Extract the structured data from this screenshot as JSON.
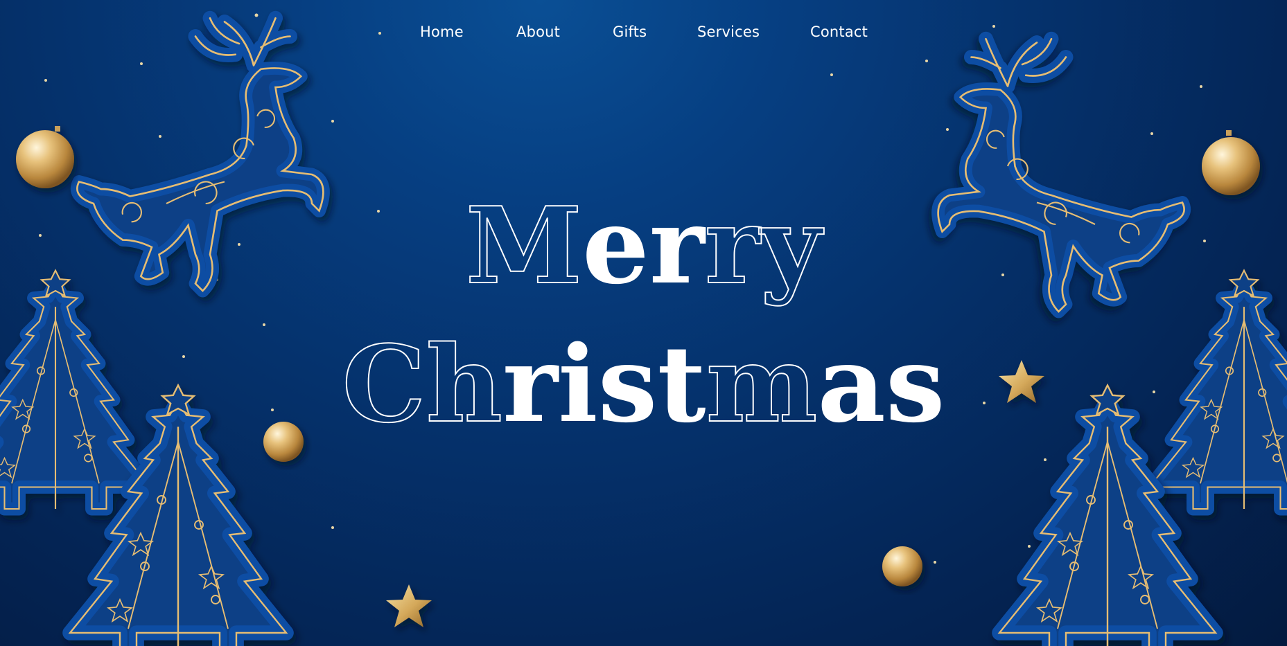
{
  "nav": {
    "items": [
      {
        "label": "Home"
      },
      {
        "label": "About"
      },
      {
        "label": "Gifts"
      },
      {
        "label": "Services"
      },
      {
        "label": "Contact"
      }
    ]
  },
  "hero": {
    "line1": {
      "outline_a": "M",
      "solid_a": "er",
      "outline_b": "ry"
    },
    "line2": {
      "outline_a": "Ch",
      "solid_a": "rist",
      "outline_b": "m",
      "solid_b": "as"
    }
  },
  "colors": {
    "background_top": "#0a4f95",
    "background_bottom": "#031a3f",
    "gold": "#e6bd73",
    "tree_fill": "#0b3f86",
    "tree_halo": "#0d4a9a",
    "text": "#ffffff"
  },
  "icons": [
    "reindeer-icon",
    "christmas-tree-icon",
    "ornament-ball-icon",
    "star-icon"
  ]
}
